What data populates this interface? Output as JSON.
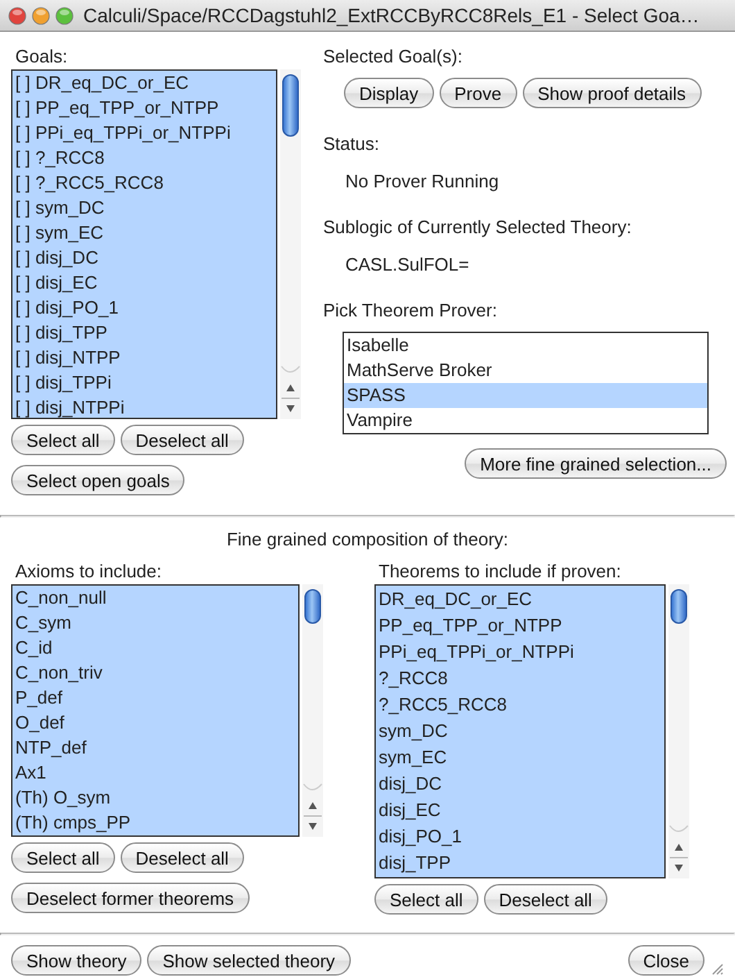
{
  "window": {
    "title": "Calculi/Space/RCCDagstuhl2_ExtRCCByRCC8Rels_E1 - Select Goa…"
  },
  "goals": {
    "label": "Goals:",
    "items": [
      {
        "text": "[ ] DR_eq_DC_or_EC",
        "selected": true
      },
      {
        "text": "[ ] PP_eq_TPP_or_NTPP",
        "selected": true
      },
      {
        "text": "[ ] PPi_eq_TPPi_or_NTPPi",
        "selected": true
      },
      {
        "text": "[ ] ?_RCC8",
        "selected": true
      },
      {
        "text": "[ ] ?_RCC5_RCC8",
        "selected": true
      },
      {
        "text": "[ ] sym_DC",
        "selected": true
      },
      {
        "text": "[ ] sym_EC",
        "selected": true
      },
      {
        "text": "[ ] disj_DC",
        "selected": true
      },
      {
        "text": "[ ] disj_EC",
        "selected": true
      },
      {
        "text": "[ ] disj_PO_1",
        "selected": true
      },
      {
        "text": "[ ] disj_TPP",
        "selected": true
      },
      {
        "text": "[ ] disj_NTPP",
        "selected": true
      },
      {
        "text": "[ ] disj_TPPi",
        "selected": true
      },
      {
        "text": "[ ] disj_NTPPi",
        "selected": true
      }
    ],
    "buttons": [
      "Select all",
      "Deselect all"
    ],
    "open_goals_button": "Select open goals"
  },
  "selected_goals": {
    "label": "Selected Goal(s):",
    "buttons": [
      "Display",
      "Prove",
      "Show proof details"
    ]
  },
  "status": {
    "label": "Status:",
    "value": "No Prover Running"
  },
  "sublogic": {
    "label": "Sublogic of Currently Selected Theory:",
    "value": "CASL.SulFOL="
  },
  "prover": {
    "label": "Pick Theorem Prover:",
    "items": [
      {
        "text": "Isabelle",
        "selected": false
      },
      {
        "text": "MathServe Broker",
        "selected": false
      },
      {
        "text": "SPASS",
        "selected": true
      },
      {
        "text": "Vampire",
        "selected": false
      }
    ],
    "button": "More fine grained selection..."
  },
  "composition": {
    "title": "Fine grained composition of theory:",
    "axioms": {
      "label": "Axioms to include:",
      "items": [
        {
          "text": "C_non_null",
          "selected": true
        },
        {
          "text": "C_sym",
          "selected": true
        },
        {
          "text": "C_id",
          "selected": true
        },
        {
          "text": "C_non_triv",
          "selected": true
        },
        {
          "text": "P_def",
          "selected": true
        },
        {
          "text": "O_def",
          "selected": true
        },
        {
          "text": "NTP_def",
          "selected": true
        },
        {
          "text": "Ax1",
          "selected": true
        },
        {
          "text": "(Th) O_sym",
          "selected": true
        },
        {
          "text": "(Th) cmps_PP",
          "selected": true
        }
      ],
      "buttons": [
        "Select all",
        "Deselect all"
      ],
      "former_button": "Deselect former theorems"
    },
    "theorems": {
      "label": "Theorems to include if proven:",
      "items": [
        {
          "text": "DR_eq_DC_or_EC",
          "selected": true
        },
        {
          "text": "PP_eq_TPP_or_NTPP",
          "selected": true
        },
        {
          "text": "PPi_eq_TPPi_or_NTPPi",
          "selected": true
        },
        {
          "text": "?_RCC8",
          "selected": true
        },
        {
          "text": "?_RCC5_RCC8",
          "selected": true
        },
        {
          "text": "sym_DC",
          "selected": true
        },
        {
          "text": "sym_EC",
          "selected": true
        },
        {
          "text": "disj_DC",
          "selected": true
        },
        {
          "text": "disj_EC",
          "selected": true
        },
        {
          "text": "disj_PO_1",
          "selected": true
        },
        {
          "text": "disj_TPP",
          "selected": true
        }
      ],
      "buttons": [
        "Select all",
        "Deselect all"
      ]
    }
  },
  "footer": {
    "buttons": [
      "Show theory",
      "Show selected theory"
    ],
    "close": "Close"
  }
}
